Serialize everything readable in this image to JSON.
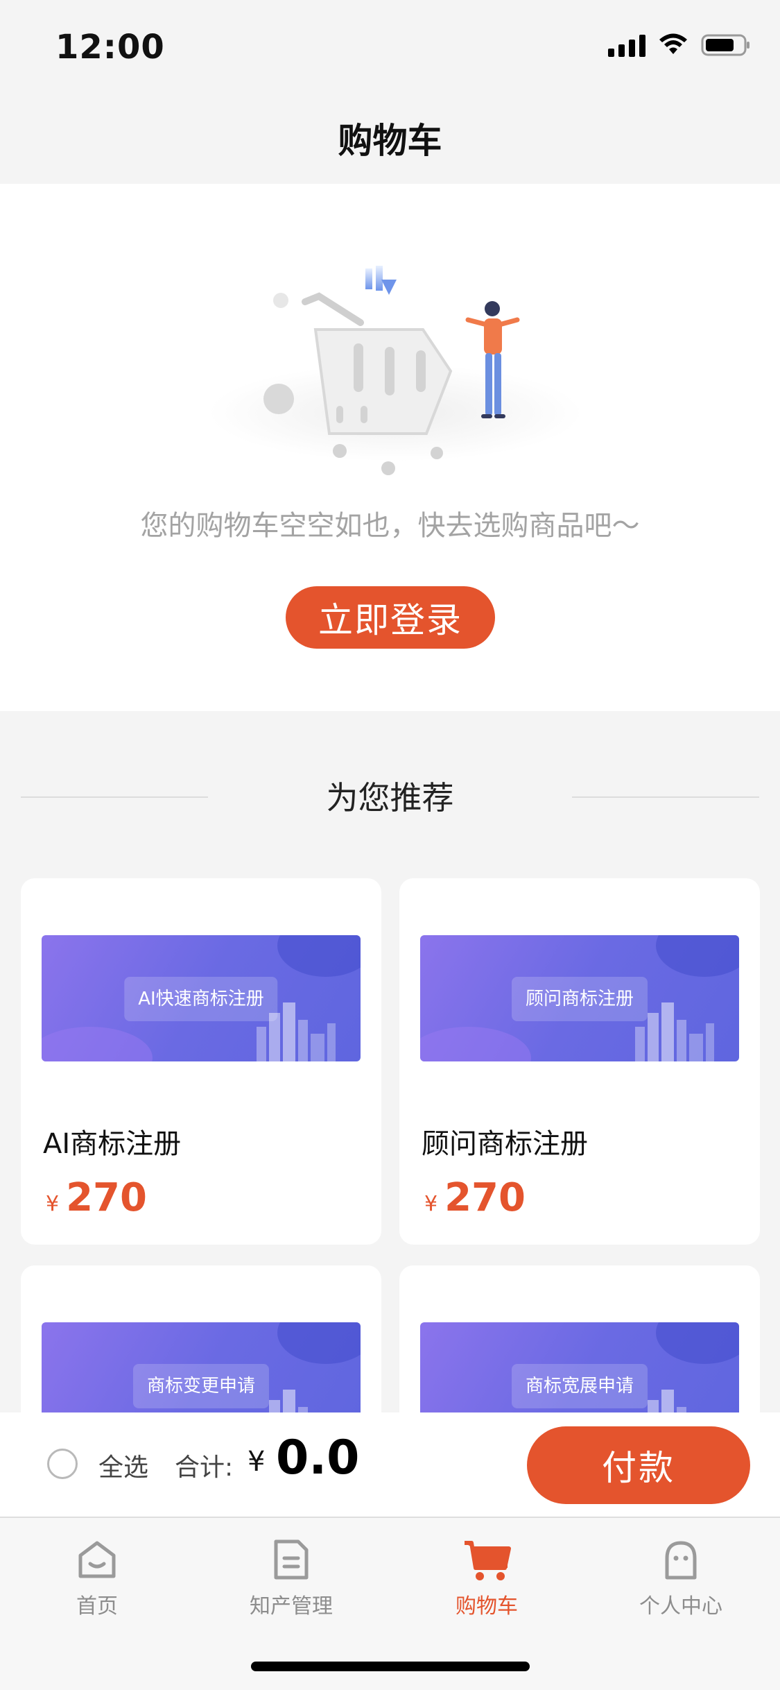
{
  "status_bar": {
    "time": "12:00"
  },
  "nav": {
    "title": "购物车"
  },
  "empty_cart": {
    "message": "您的购物车空空如也，快去选购商品吧～",
    "login_label": "立即登录"
  },
  "recommend": {
    "title": "为您推荐",
    "products": [
      {
        "banner": "AI快速商标注册",
        "name": "AI商标注册",
        "currency": "¥",
        "price": "270"
      },
      {
        "banner": "顾问商标注册",
        "name": "顾问商标注册",
        "currency": "¥",
        "price": "270"
      },
      {
        "banner": "商标变更申请"
      },
      {
        "banner": "商标宽展申请"
      }
    ]
  },
  "checkout": {
    "select_all": "全选",
    "total_label": "合计:",
    "currency": "¥",
    "total": "0.0",
    "pay_label": "付款"
  },
  "tabbar": {
    "items": [
      {
        "label": "首页",
        "icon": "home-icon"
      },
      {
        "label": "知产管理",
        "icon": "document-icon"
      },
      {
        "label": "购物车",
        "icon": "cart-icon"
      },
      {
        "label": "个人中心",
        "icon": "profile-icon"
      }
    ],
    "active_index": 2
  },
  "colors": {
    "accent": "#e4542d",
    "banner": "#6a6ae3",
    "muted": "#a3a3a3"
  }
}
